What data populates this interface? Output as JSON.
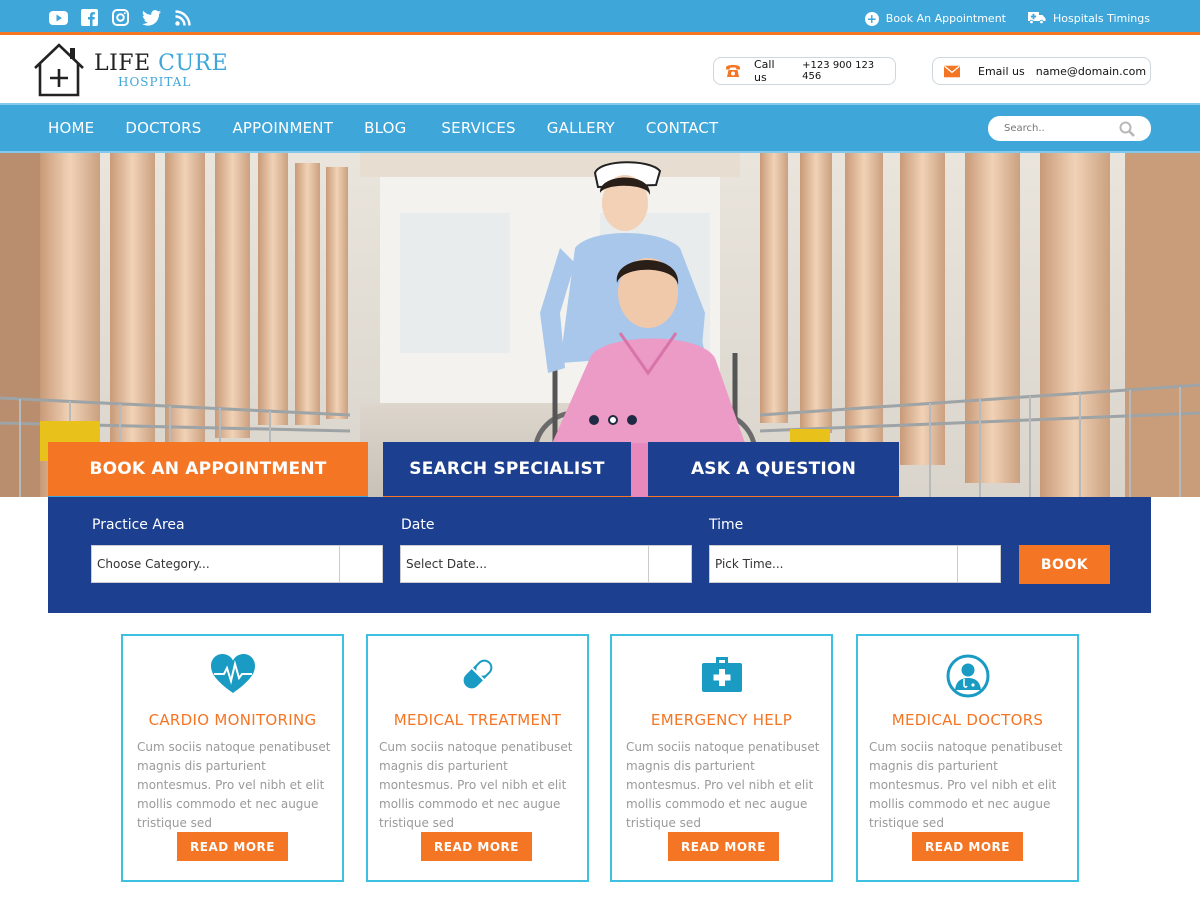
{
  "topbar": {
    "social_icons": [
      "youtube-icon",
      "facebook-icon",
      "instagram-icon",
      "twitter-icon",
      "rss-icon"
    ],
    "book_appointment": "Book An Appointment",
    "hospital_timings": "Hospitals Timings"
  },
  "header": {
    "logo_line1_a": "LIFE",
    "logo_line1_b": "CURE",
    "logo_line2": "HOSPITAL",
    "call_label": "Call us",
    "call_value": "+123 900 123 456",
    "email_label": "Email us",
    "email_value": "name@domain.com"
  },
  "nav": {
    "items": [
      "HOME",
      "DOCTORS",
      "APPOINMENT",
      "BLOG",
      "SERVICES",
      "GALLERY",
      "CONTACT"
    ],
    "search_placeholder": "Search.."
  },
  "tabs": {
    "book": "BOOK AN APPOINTMENT",
    "search": "SEARCH SPECIALIST",
    "ask": "ASK A QUESTION"
  },
  "booking": {
    "practice_label": "Practice Area",
    "practice_value": "Choose Category...",
    "date_label": "Date",
    "date_value": "Select Date...",
    "time_label": "Time",
    "time_value": "Pick Time...",
    "book_button": "BOOK"
  },
  "cards": [
    {
      "title": "CARDIO MONITORING",
      "text": "Cum sociis natoque penatibuset magnis dis parturient montesmus. Pro vel nibh et elit mollis commodo et nec augue tristique sed",
      "button": "READ MORE",
      "icon": "heart-pulse-icon"
    },
    {
      "title": "MEDICAL TREATMENT",
      "text": "Cum sociis natoque penatibuset magnis dis parturient montesmus. Pro vel nibh et elit mollis commodo et nec augue tristique sed",
      "button": "READ MORE",
      "icon": "pill-icon"
    },
    {
      "title": "EMERGENCY HELP",
      "text": "Cum sociis natoque penatibuset magnis dis parturient montesmus. Pro vel nibh et elit mollis commodo et nec augue tristique sed",
      "button": "READ MORE",
      "icon": "first-aid-kit-icon"
    },
    {
      "title": "MEDICAL DOCTORS",
      "text": "Cum sociis natoque penatibuset magnis dis parturient montesmus. Pro vel nibh et elit mollis commodo et nec augue tristique sed",
      "button": "READ MORE",
      "icon": "doctor-icon"
    }
  ],
  "slider": {
    "dots": 3,
    "active_dot": 1
  },
  "colors": {
    "primary_blue": "#3ea6d9",
    "navy": "#1d3f8f",
    "orange": "#f47524",
    "card_border": "#3ec1e0",
    "icon_teal": "#1a9bc4"
  }
}
